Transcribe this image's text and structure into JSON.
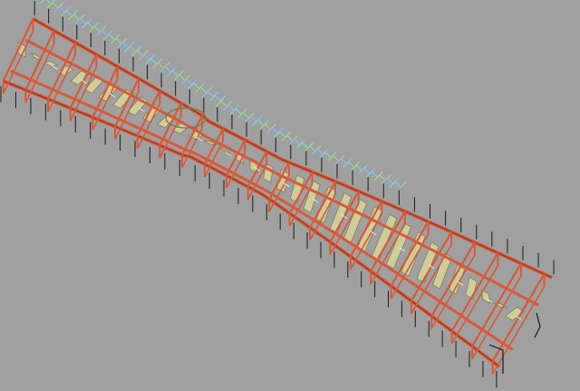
{
  "viewport": {
    "background": "#a0a0a0",
    "model": "structural-frame-render"
  },
  "colors": {
    "beam": "#d65a3a",
    "beam_dark": "#8a2f1d",
    "plate": "#d8d39a",
    "plate_edge": "#7c7a4c",
    "cyan": "#7fd9d6",
    "green": "#a6d87a",
    "blue": "#8fb8ff",
    "black": "#1b1b1b",
    "white_edge": "#f2f2f2"
  }
}
